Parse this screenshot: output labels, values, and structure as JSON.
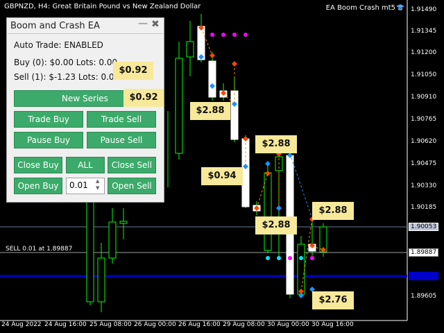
{
  "header": {
    "symbol_info": "GBPNZD, H4:  Great Britain Pound vs New Zealand Dollar",
    "ea_name": "EA Boom Crash mt5"
  },
  "y_axis": {
    "labels": [
      "1.91490",
      "1.91345",
      "1.91200",
      "1.91050",
      "1.90910",
      "1.90765",
      "1.90620",
      "1.90475",
      "1.90330",
      "1.90185",
      "1.89887",
      "1.89605"
    ],
    "current_price": "1.90053",
    "sell_price": "1.89887",
    "blue_line_price": "1.89745"
  },
  "x_axis": {
    "labels": [
      "24 Aug 2022",
      "24 Aug 16:00",
      "25 Aug 08:00",
      "26 Aug 00:00",
      "26 Aug 16:00",
      "29 Aug 08:00",
      "30 Aug 00:00",
      "30 Aug 16:00"
    ]
  },
  "sell_line_label": "SELL 0.01 at 1.89887",
  "panel": {
    "title": "Boom and Crash EA",
    "min_icon": "minimize-icon",
    "close_icon": "close-icon",
    "auto_trade": "Auto Trade: ENABLED",
    "buy_info": "Buy (0): $0.00 Lots: 0.00",
    "sell_info": "Sell (1): $-1.23 Lots: 0.01",
    "buttons": {
      "new_series": "New Series",
      "trade_buy": "Trade Buy",
      "trade_sell": "Trade Sell",
      "pause_buy": "Pause Buy",
      "pause_sell": "Pause Sell",
      "close_buy": "Close Buy",
      "all": "ALL",
      "close_sell": "Close Sell",
      "open_buy": "Open Buy",
      "open_sell": "Open Sell"
    },
    "lots_value": "0.01"
  },
  "tags": [
    "$0.92",
    "$0.92",
    "$2.88",
    "$2.88",
    "$0.94",
    "$2.88",
    "$2.88",
    "$2.76"
  ],
  "colors": {
    "bull": "#00ff00",
    "bear": "#ffffff",
    "blue_line": "#0000cd",
    "panel_btn": "#3caa6a",
    "tag_bg": "#f7e99a"
  }
}
